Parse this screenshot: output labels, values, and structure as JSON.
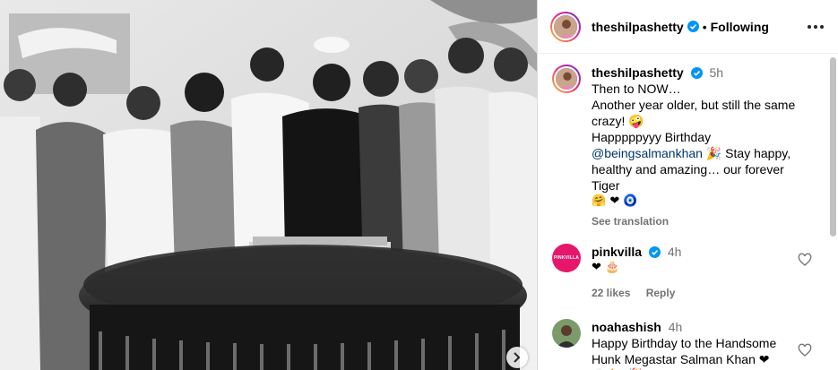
{
  "post": {
    "author": "theshilpashetty",
    "follow_state": "Following"
  },
  "caption": {
    "author": "theshilpashetty",
    "time": "5h",
    "line1": "Then to NOW…",
    "line2": "Another year older, but still the same",
    "line3": "crazy! 🤪",
    "line4": "Happpppyyy Birthday",
    "mention": "@beingsalmankhan",
    "line5_rest": "🎉  Stay happy,",
    "line6": "healthy and amazing… our forever Tiger",
    "line7": "🤗 ❤ 🧿",
    "see_translation": "See translation"
  },
  "comments": [
    {
      "author": "pinkvilla",
      "avatar_text": "PINKVILLA",
      "time": "4h",
      "text": "❤ 🎂",
      "likes": "22 likes",
      "reply": "Reply"
    },
    {
      "author": "noahashish",
      "time": "4h",
      "text1": "Happy Birthday to the Handsome",
      "text2": "Hunk Megastar Salman Khan ❤",
      "text3": "🙌 🍾 🎉"
    }
  ],
  "colors": {
    "verified": "#0095f6",
    "pinkvilla": "#e6176b",
    "link": "#00376b"
  }
}
